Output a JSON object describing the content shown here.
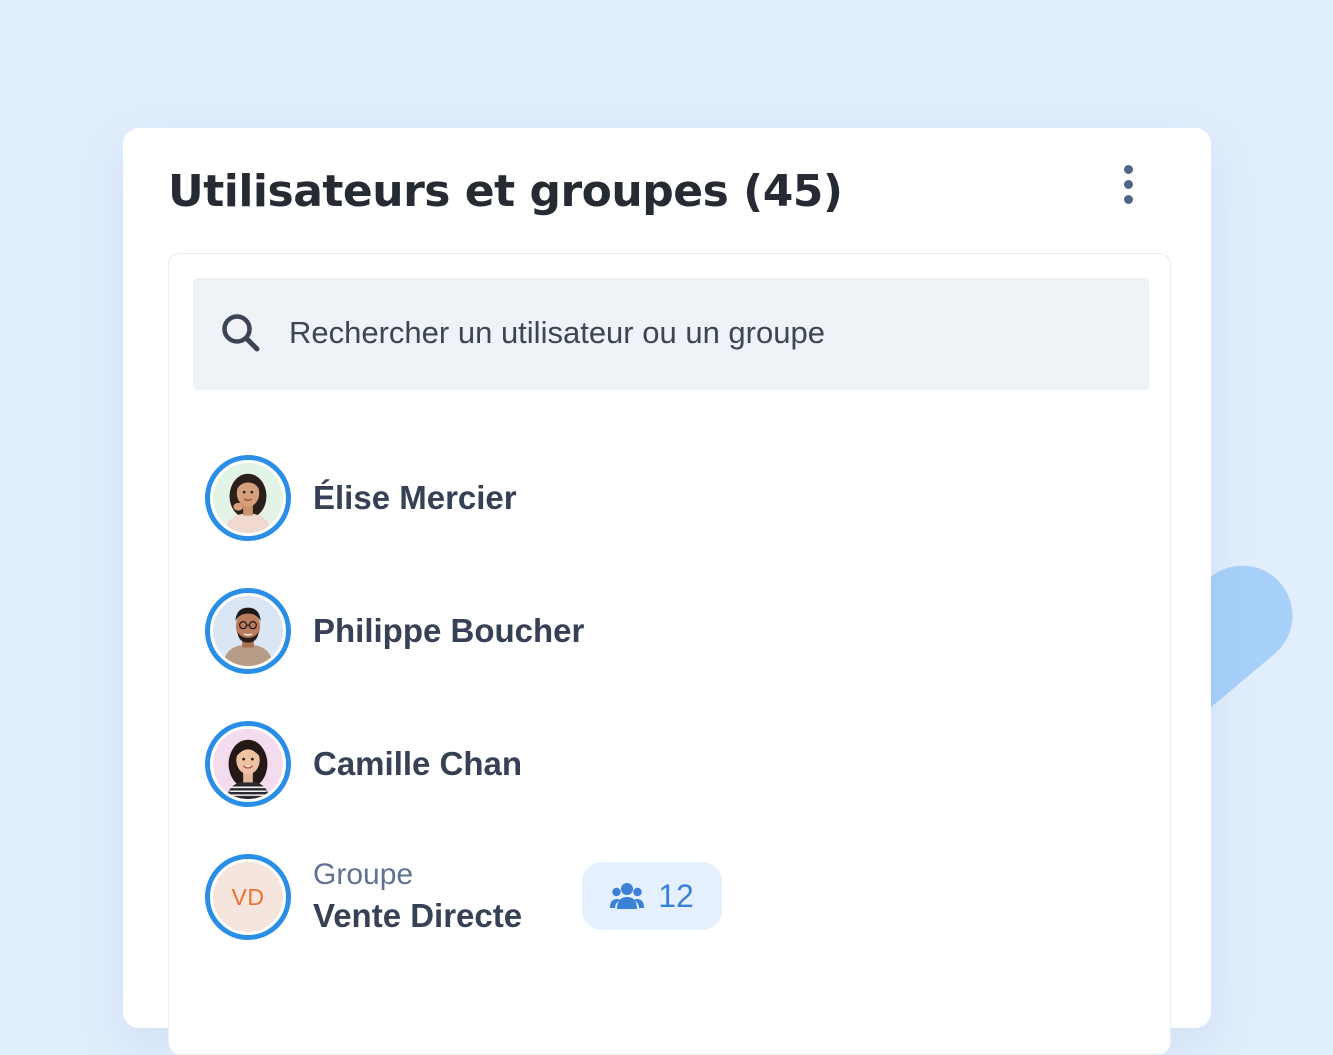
{
  "panel": {
    "title": "Utilisateurs et groupes (45)",
    "menu_icon": "vertical-dots-icon"
  },
  "search": {
    "icon": "search-icon",
    "placeholder": "Rechercher un utilisateur ou un groupe"
  },
  "items": [
    {
      "type": "user",
      "name": "Élise Mercier"
    },
    {
      "type": "user",
      "name": "Philippe Boucher"
    },
    {
      "type": "user",
      "name": "Camille Chan"
    },
    {
      "type": "group",
      "label": "Groupe",
      "name": "Vente Directe",
      "initials": "VD",
      "member_count": "12",
      "member_icon": "users-icon"
    }
  ],
  "colors": {
    "background": "#e1eefd",
    "avatar_ring": "#2a8de6",
    "title_text": "#252a33",
    "name_text": "#364155",
    "group_label_text": "#5f7392",
    "initials_text": "#ee7031",
    "badge_background": "#e4f0fd",
    "badge_text": "#3b82d6"
  }
}
